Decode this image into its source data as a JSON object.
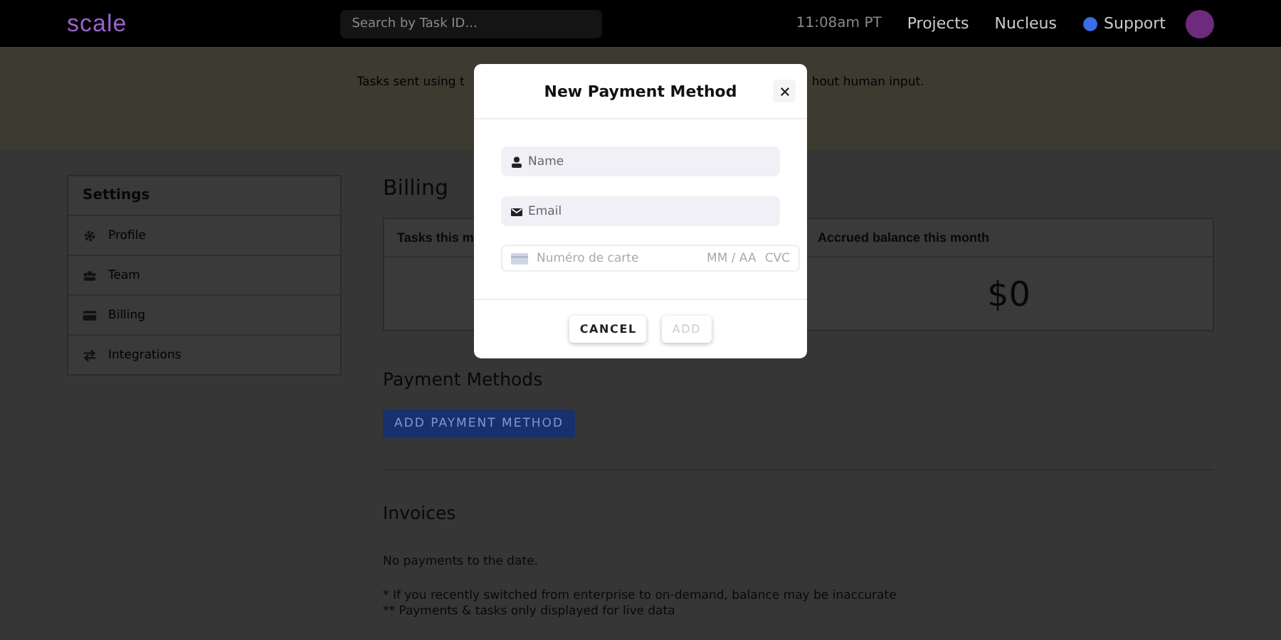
{
  "nav": {
    "logo": "scale",
    "search": {
      "placeholder": "Search by Task ID..."
    },
    "time": "11:08am PT",
    "links": [
      "Projects",
      "Nucleus"
    ],
    "support": "Support"
  },
  "banner": {
    "left": "Tasks sent using t",
    "right": "hout human input."
  },
  "sidebar": {
    "title": "Settings",
    "items": [
      {
        "label": "Profile",
        "selected": false
      },
      {
        "label": "Team",
        "selected": false
      },
      {
        "label": "Billing",
        "selected": false
      },
      {
        "label": "Integrations",
        "selected": false
      }
    ]
  },
  "billing": {
    "title": "Billing",
    "cards": [
      {
        "title": "Tasks this m"
      },
      {
        "title": "Accrued balance this month",
        "value": "$0"
      }
    ]
  },
  "payment_methods": {
    "title": "Payment Methods",
    "button": "ADD PAYMENT METHOD"
  },
  "invoices": {
    "title": "Invoices",
    "empty": "No payments to the date.",
    "notes": [
      "* If you recently switched from enterprise to on-demand, balance may be inaccurate",
      "** Payments & tasks only displayed for live data"
    ]
  },
  "modal": {
    "title": "New Payment Method",
    "fields": [
      {
        "kind": "name",
        "placeholder": "Name"
      },
      {
        "kind": "email",
        "placeholder": "Email"
      }
    ],
    "card": {
      "placeholder": "Numéro de carte",
      "expiry": "MM / AA",
      "cvc": "CVC"
    },
    "buttons": [
      {
        "label": "CANCEL",
        "disabled": false
      },
      {
        "label": "ADD",
        "disabled": true
      }
    ]
  }
}
